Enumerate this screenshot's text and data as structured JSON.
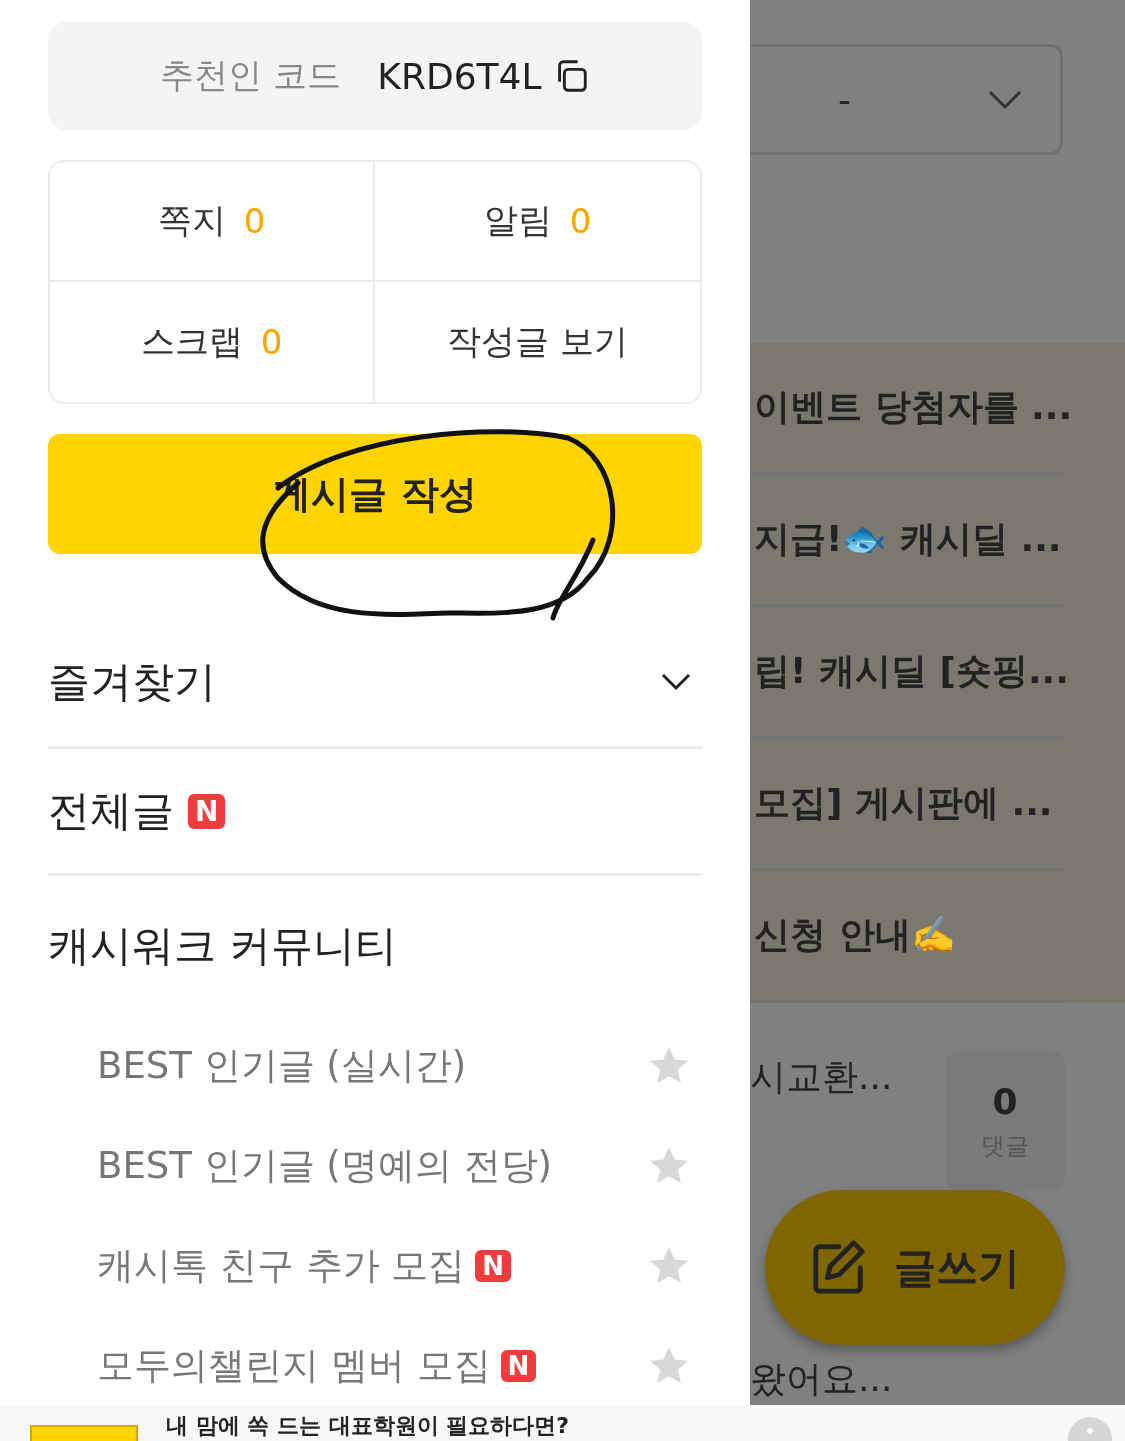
{
  "drawer": {
    "referral": {
      "label": "추천인 코드",
      "code": "KRD6T4L"
    },
    "stats": [
      {
        "label": "쪽지",
        "count": "0"
      },
      {
        "label": "알림",
        "count": "0"
      },
      {
        "label": "스크랩",
        "count": "0"
      },
      {
        "label": "작성글 보기"
      }
    ],
    "write_button": "게시글 작성",
    "menu": [
      {
        "kind": "collapsible",
        "label": "즐겨찾기",
        "expanded": false
      },
      {
        "kind": "link",
        "label": "전체글",
        "new": true,
        "new_badge": "N"
      },
      {
        "kind": "section",
        "label": "캐시워크 커뮤니티",
        "children": [
          {
            "label": "BEST 인기글 (실시간)",
            "new": false,
            "starred": false
          },
          {
            "label": "BEST 인기글 (명예의 전당)",
            "new": false,
            "starred": false
          },
          {
            "label": "캐시톡 친구 추가 모집",
            "new": true,
            "new_badge": "N",
            "starred": false
          },
          {
            "label": "모두의챌린지 멤버 모집",
            "new": true,
            "new_badge": "N",
            "starred": false
          }
        ]
      }
    ]
  },
  "background_page": {
    "filter": {
      "value": "-"
    },
    "notices": [
      "이벤트 당첨자를 ...",
      "지급!🐟 캐시딜 ...",
      "립! 캐시딜 [숏핑...",
      "모집] 게시판에 ...",
      "신청 안내✍️"
    ],
    "posts": [
      {
        "title": "시교환...",
        "comments": "0",
        "comments_label": "댓글"
      },
      {
        "title": "왔어요..."
      }
    ],
    "fab": "글쓰기"
  },
  "banner": {
    "text": "내 맘에 쏙 드는 대표학원이 필요하다면?"
  }
}
